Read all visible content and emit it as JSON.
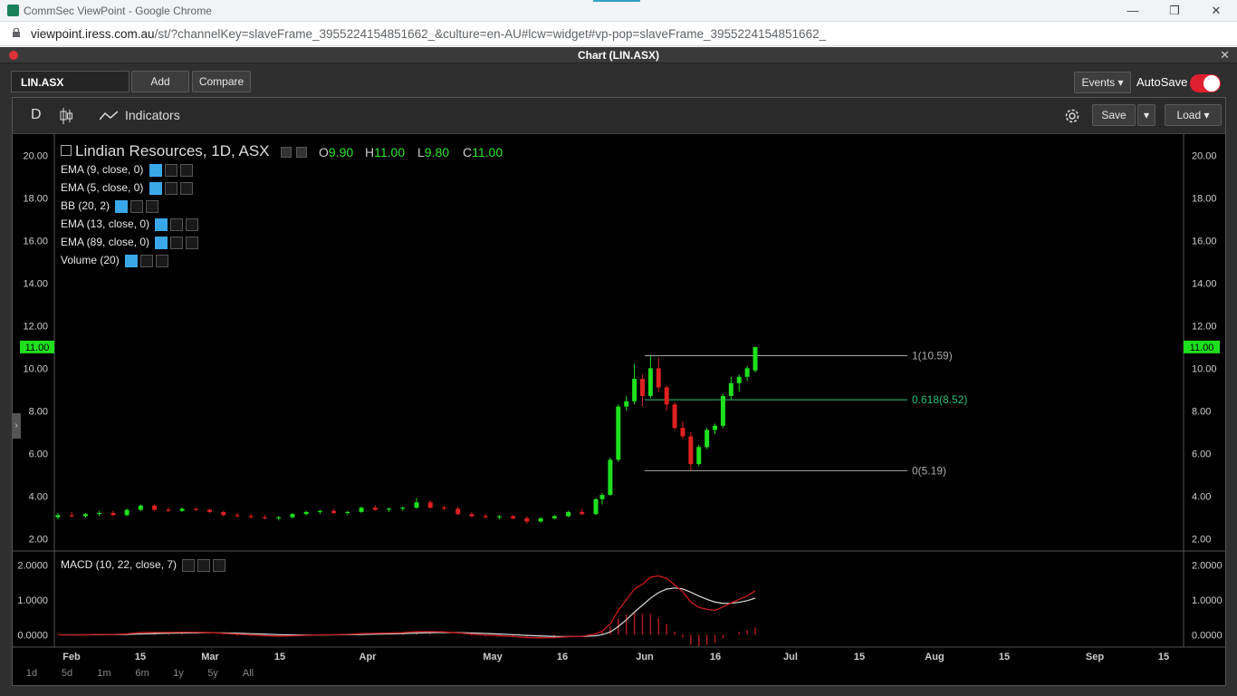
{
  "browser": {
    "tab_title": "CommSec ViewPoint - Google Chrome",
    "url_domain": "viewpoint.iress.com.au",
    "url_path": "/st/?channelKey=slaveFrame_3955224154851662_&culture=en-AU#lcw=widget#vp-pop=slaveFrame_3955224154851662_",
    "minimize": "—",
    "restore": "❐",
    "close": "✕"
  },
  "panel": {
    "title": "Chart (LIN.ASX)",
    "close": "✕"
  },
  "toolbar": {
    "symbol": "LIN.ASX",
    "add": "Add",
    "compare": "Compare",
    "events": "Events",
    "autosave": "AutoSave",
    "autosave_on": true
  },
  "chart_toolbar": {
    "interval": "D",
    "indicators": "Indicators",
    "save": "Save",
    "load": "Load"
  },
  "header": {
    "title": "Lindian Resources, 1D, ASX",
    "o_label": "O",
    "o": "9.90",
    "h_label": "H",
    "h": "11.00",
    "l_label": "L",
    "l": "9.80",
    "c_label": "C",
    "c": "11.00"
  },
  "legend": [
    {
      "label": "EMA (9, close, 0)"
    },
    {
      "label": "EMA (5, close, 0)"
    },
    {
      "label": "BB (20, 2)"
    },
    {
      "label": "EMA (13, close, 0)"
    },
    {
      "label": "EMA (89, close, 0)"
    },
    {
      "label": "Volume (20)"
    }
  ],
  "macd_label": "MACD (10, 22, close, 7)",
  "price_axis_labels": [
    "20.00",
    "18.00",
    "16.00",
    "14.00",
    "12.00",
    "10.00",
    "8.00",
    "6.00",
    "4.00",
    "2.00"
  ],
  "last_price_badge": "11.00",
  "macd_axis_labels": [
    "2.0000",
    "1.0000",
    "0.0000"
  ],
  "time_axis_labels": [
    "Feb",
    "15",
    "Mar",
    "15",
    "Apr",
    "May",
    "16",
    "Jun",
    "16",
    "Jul",
    "15",
    "Aug",
    "15",
    "Sep",
    "15"
  ],
  "fib_labels": [
    "1(10.59)",
    "0.618(8.52)",
    "0(5.19)"
  ],
  "ranges": [
    "1d",
    "5d",
    "1m",
    "6m",
    "1y",
    "5y",
    "All"
  ],
  "colors": {
    "up": "#1ee01e",
    "down": "#e02020",
    "fib_main": "#aaaaaa",
    "fib_mid": "#2fbf7a",
    "badge": "#1ee01e"
  },
  "chart_data": {
    "type": "candlestick",
    "title": "Lindian Resources, 1D, ASX",
    "ylim": [
      1.5,
      21
    ],
    "candles": [
      [
        3.0,
        3.2,
        2.9,
        3.1
      ],
      [
        3.1,
        3.25,
        3.0,
        3.05
      ],
      [
        3.05,
        3.2,
        3.0,
        3.15
      ],
      [
        3.15,
        3.3,
        3.05,
        3.2
      ],
      [
        3.2,
        3.3,
        3.05,
        3.1
      ],
      [
        3.1,
        3.4,
        3.05,
        3.35
      ],
      [
        3.35,
        3.6,
        3.3,
        3.55
      ],
      [
        3.55,
        3.6,
        3.3,
        3.35
      ],
      [
        3.35,
        3.45,
        3.25,
        3.3
      ],
      [
        3.3,
        3.45,
        3.25,
        3.4
      ],
      [
        3.4,
        3.45,
        3.3,
        3.35
      ],
      [
        3.35,
        3.4,
        3.2,
        3.25
      ],
      [
        3.25,
        3.3,
        3.05,
        3.1
      ],
      [
        3.1,
        3.2,
        3.0,
        3.05
      ],
      [
        3.05,
        3.15,
        2.95,
        3.0
      ],
      [
        3.0,
        3.1,
        2.9,
        2.95
      ],
      [
        2.95,
        3.05,
        2.85,
        3.0
      ],
      [
        3.0,
        3.2,
        2.95,
        3.15
      ],
      [
        3.15,
        3.3,
        3.1,
        3.25
      ],
      [
        3.25,
        3.35,
        3.15,
        3.3
      ],
      [
        3.3,
        3.4,
        3.15,
        3.2
      ],
      [
        3.2,
        3.3,
        3.1,
        3.25
      ],
      [
        3.25,
        3.5,
        3.2,
        3.45
      ],
      [
        3.45,
        3.55,
        3.3,
        3.35
      ],
      [
        3.35,
        3.45,
        3.25,
        3.4
      ],
      [
        3.4,
        3.5,
        3.3,
        3.45
      ],
      [
        3.45,
        3.9,
        3.4,
        3.7
      ],
      [
        3.7,
        3.8,
        3.4,
        3.45
      ],
      [
        3.45,
        3.55,
        3.35,
        3.4
      ],
      [
        3.4,
        3.5,
        3.1,
        3.15
      ],
      [
        3.15,
        3.25,
        3.0,
        3.05
      ],
      [
        3.05,
        3.15,
        2.95,
        3.0
      ],
      [
        3.0,
        3.1,
        2.9,
        3.05
      ],
      [
        3.05,
        3.1,
        2.9,
        2.95
      ],
      [
        2.95,
        3.05,
        2.7,
        2.8
      ],
      [
        2.8,
        3.0,
        2.75,
        2.95
      ],
      [
        2.95,
        3.1,
        2.9,
        3.05
      ],
      [
        3.05,
        3.3,
        3.0,
        3.25
      ],
      [
        3.25,
        3.4,
        3.1,
        3.15
      ],
      [
        3.15,
        3.9,
        3.1,
        3.85
      ],
      [
        3.85,
        4.15,
        3.6,
        4.05
      ],
      [
        4.05,
        5.8,
        4.0,
        5.7
      ],
      [
        5.7,
        8.3,
        5.6,
        8.2
      ],
      [
        8.2,
        8.7,
        8.0,
        8.45
      ],
      [
        8.45,
        10.2,
        8.3,
        9.5
      ],
      [
        9.5,
        9.7,
        8.2,
        8.7
      ],
      [
        8.7,
        10.6,
        8.6,
        10.0
      ],
      [
        10.0,
        10.5,
        8.9,
        9.1
      ],
      [
        9.1,
        9.2,
        8.0,
        8.3
      ],
      [
        8.3,
        8.4,
        7.1,
        7.2
      ],
      [
        7.2,
        7.5,
        6.7,
        6.8
      ],
      [
        6.8,
        7.0,
        5.2,
        5.5
      ],
      [
        5.5,
        6.4,
        5.4,
        6.3
      ],
      [
        6.3,
        7.2,
        6.2,
        7.1
      ],
      [
        7.1,
        7.4,
        6.9,
        7.3
      ],
      [
        7.3,
        8.8,
        7.2,
        8.7
      ],
      [
        8.7,
        9.6,
        8.5,
        9.3
      ],
      [
        9.3,
        9.7,
        8.9,
        9.6
      ],
      [
        9.6,
        10.1,
        9.4,
        10.0
      ],
      [
        9.9,
        11.0,
        9.8,
        11.0
      ]
    ],
    "fib_levels": [
      10.59,
      8.52,
      5.19
    ],
    "macd_ylim": [
      -0.3,
      2.3
    ]
  }
}
